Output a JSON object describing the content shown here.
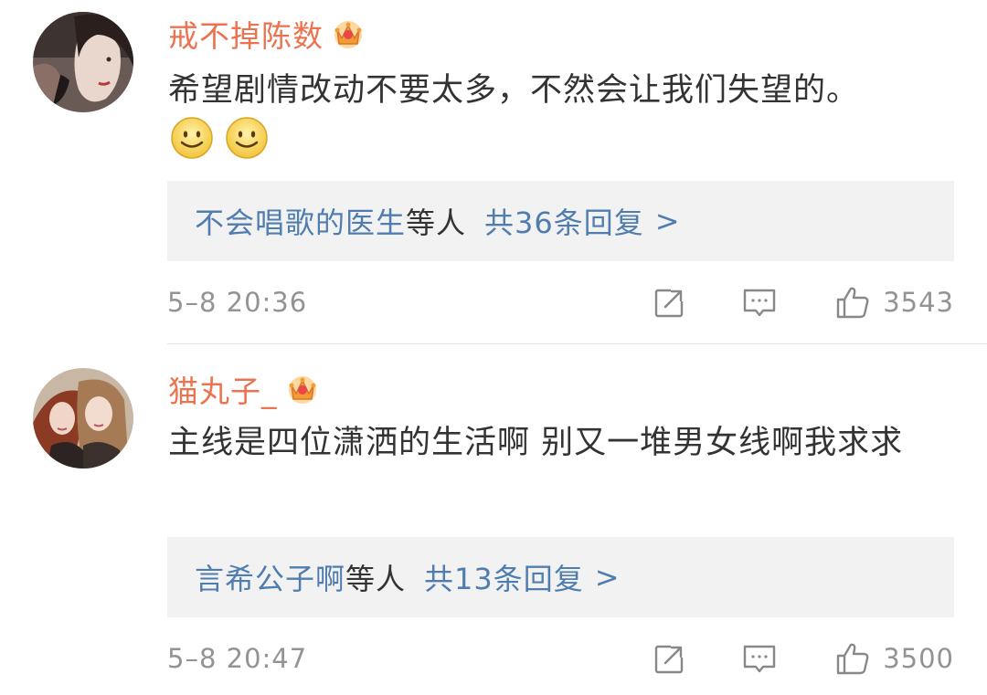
{
  "colors": {
    "username": "#eb7350",
    "link": "#507daf",
    "body_text": "#333333",
    "meta_text": "#939393",
    "reply_bg": "#f2f2f2"
  },
  "comments": [
    {
      "username": "戒不掉陈数",
      "badge_icon": "crown-icon",
      "text": "希望剧情改动不要太多，不然会让我们失望的。",
      "emojis": [
        "smile-emoji",
        "smile-emoji"
      ],
      "reply_users": "不会唱歌的医生",
      "reply_etc": "等人",
      "reply_count": "共36条回复",
      "reply_arrow": ">",
      "time": "5–8 20:36",
      "likes": "3543"
    },
    {
      "username": "猫丸子_",
      "badge_icon": "crown-icon",
      "text": "主线是四位潇洒的生活啊 别又一堆男女线啊我求求",
      "emojis": [],
      "reply_users": "言希公子啊",
      "reply_etc": "等人",
      "reply_count": "共13条回复",
      "reply_arrow": ">",
      "time": "5–8 20:47",
      "likes": "3500"
    }
  ]
}
